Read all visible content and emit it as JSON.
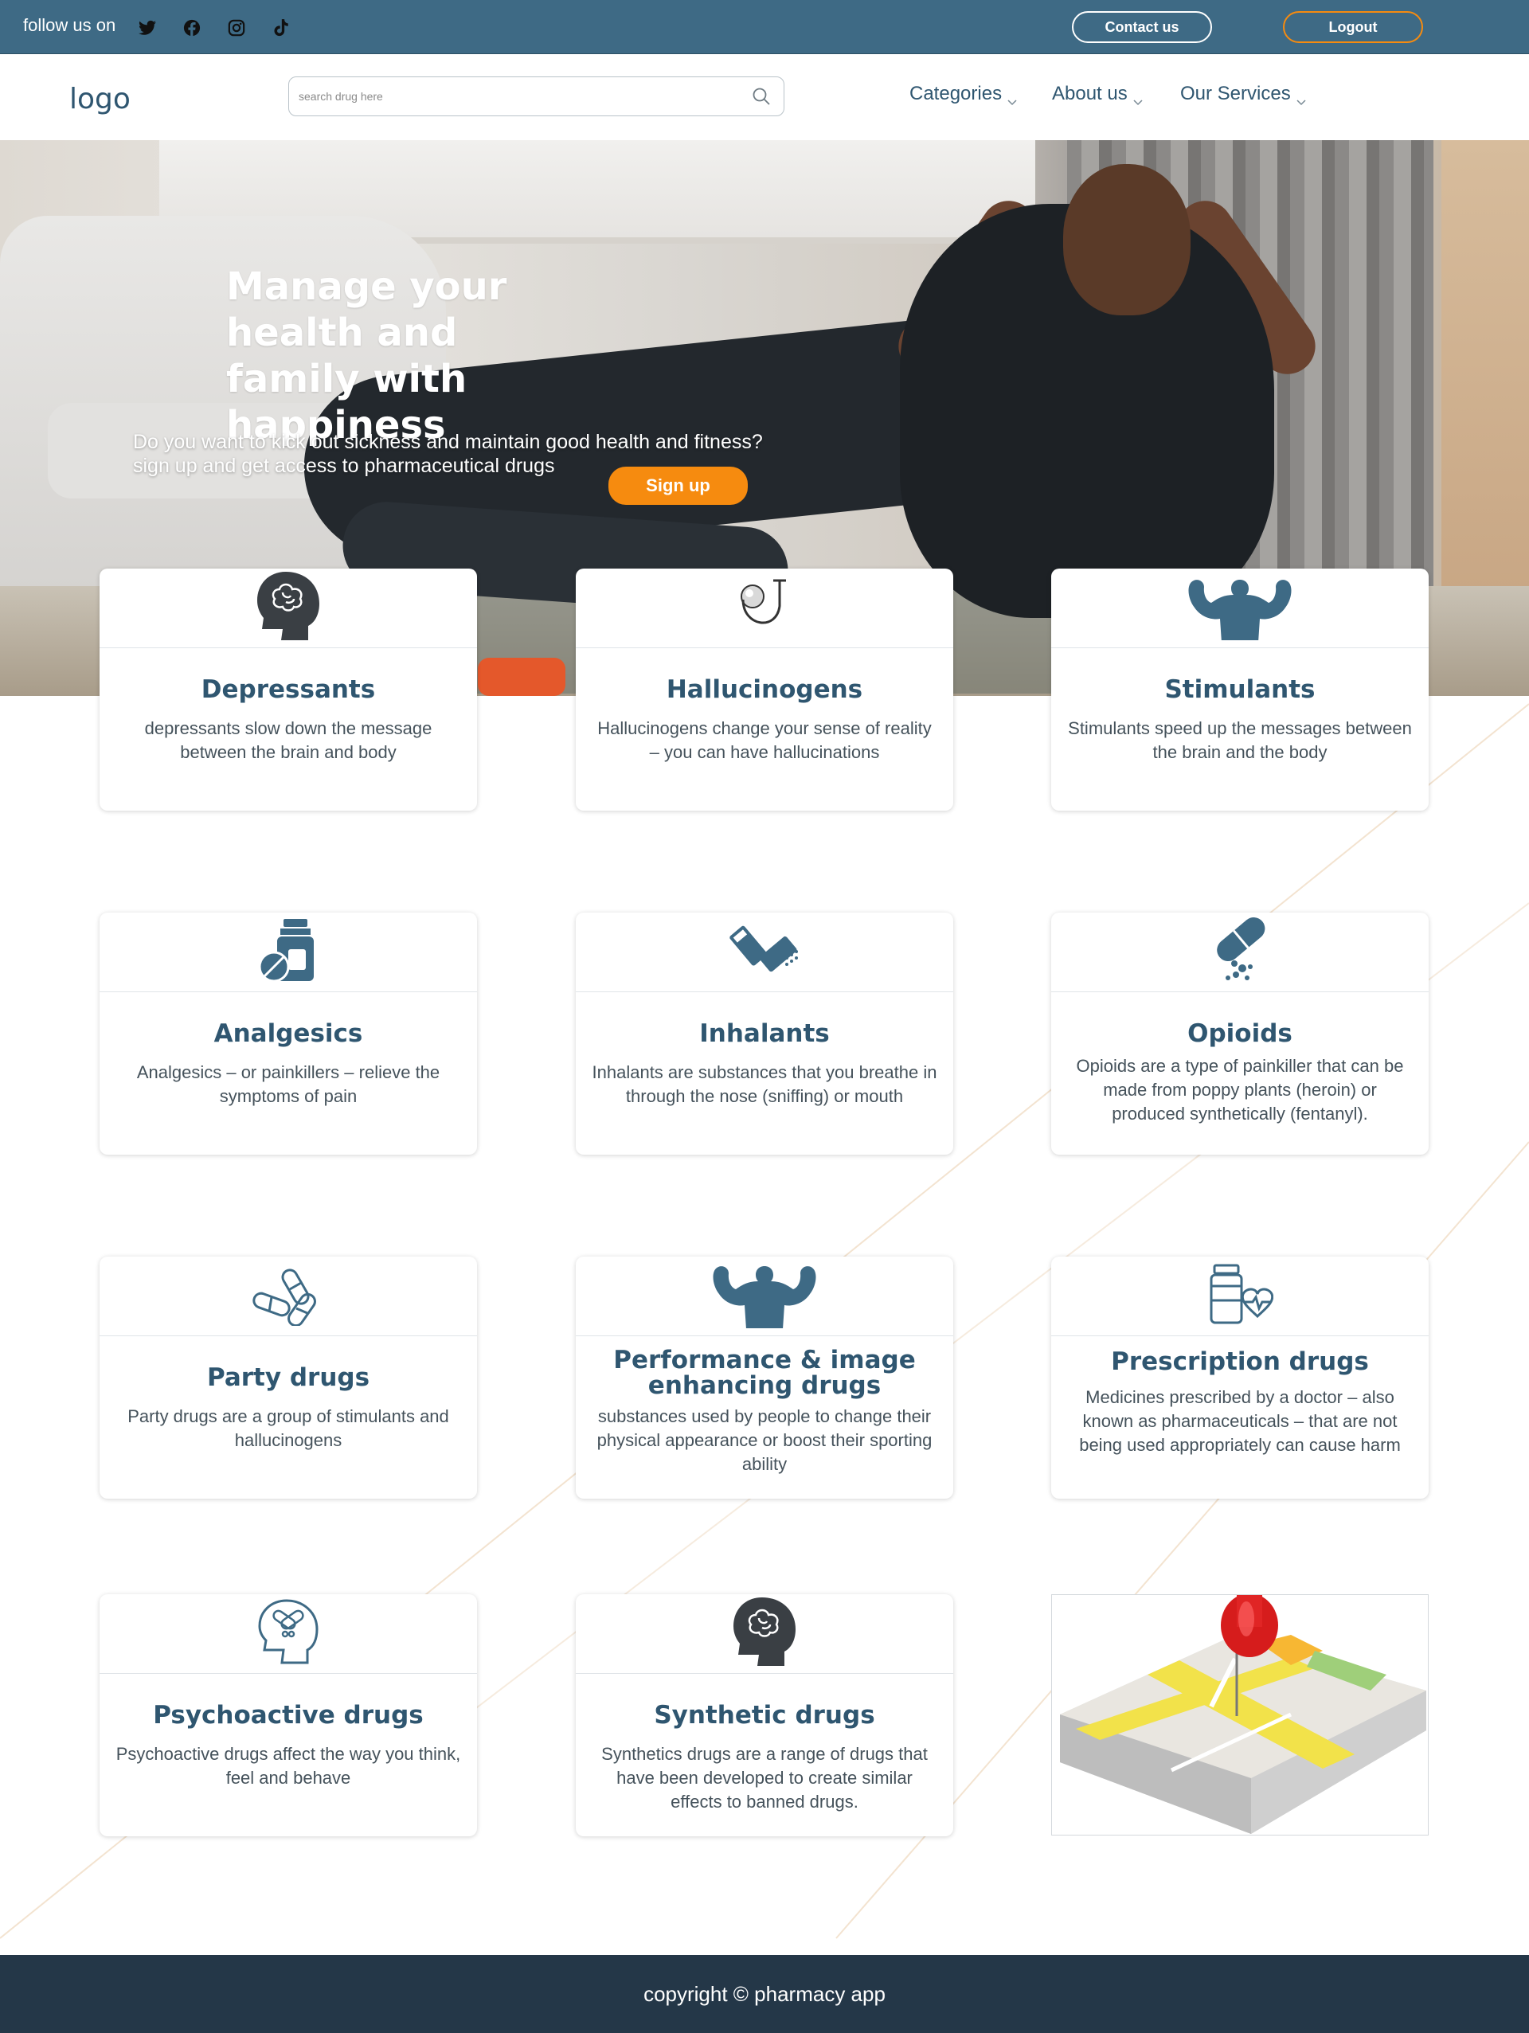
{
  "topbar": {
    "follow_label": "follow us on",
    "social": [
      "twitter-icon",
      "facebook-icon",
      "instagram-icon",
      "tiktok-icon"
    ],
    "contact_label": "Contact us",
    "logout_label": "Logout",
    "accent": "#f68b0f",
    "background": "#3e6a85"
  },
  "nav": {
    "logo": "logo",
    "search_placeholder": "search drug here",
    "search_value": "",
    "menu": [
      {
        "label": "Categories"
      },
      {
        "label": "About us"
      },
      {
        "label": "Our Services"
      }
    ]
  },
  "hero": {
    "title": "Manage your health and family with happiness",
    "subtitle_line1": "Do you want to kick out sickness and maintain good health and fitness?",
    "subtitle_line2": "sign up and get access to pharmaceutical drugs",
    "signup_label": "Sign up"
  },
  "categories": [
    {
      "title": "Depressants",
      "desc": "depressants slow down the message between the brain and body",
      "icon": "brain-head-icon"
    },
    {
      "title": "Hallucinogens",
      "desc": "Hallucinogens change your sense of reality – you can have hallucinations",
      "icon": "stethoscope-icon"
    },
    {
      "title": "Stimulants",
      "desc": "Stimulants speed up the messages between the brain and the body",
      "icon": "muscle-man-icon"
    },
    {
      "title": "Analgesics",
      "desc": "Analgesics – or painkillers – relieve the symptoms of pain",
      "icon": "medicine-bottle-icon"
    },
    {
      "title": "Inhalants",
      "desc": "Inhalants are substances that you breathe in through the nose (sniffing) or mouth",
      "icon": "inhaler-icon"
    },
    {
      "title": "Opioids",
      "desc": "Opioids are a type of painkiller that can be made from poppy plants (heroin) or produced synthetically (fentanyl).",
      "icon": "capsule-icon"
    },
    {
      "title": "Party drugs",
      "desc": "Party drugs are a group of stimulants and hallucinogens",
      "icon": "pills-icon"
    },
    {
      "title": "Performance & image enhancing drugs",
      "desc": "substances used by people to change their physical appearance or boost their sporting ability",
      "icon": "bodybuilder-icon"
    },
    {
      "title": "Prescription drugs",
      "desc": "Medicines prescribed by a doctor – also known as pharmaceuticals – that are not being used appropriately can cause harm",
      "icon": "prescription-bottle-heart-icon"
    },
    {
      "title": "Psychoactive drugs",
      "desc": "Psychoactive drugs affect the way you think, feel and behave",
      "icon": "head-pills-icon"
    },
    {
      "title": "Synthetic drugs",
      "desc": "Synthetics drugs are a range of drugs that have been developed to create similar effects to banned drugs.",
      "icon": "brain-head-icon"
    }
  ],
  "footer": {
    "copyright": "copyright © pharmacy app"
  }
}
